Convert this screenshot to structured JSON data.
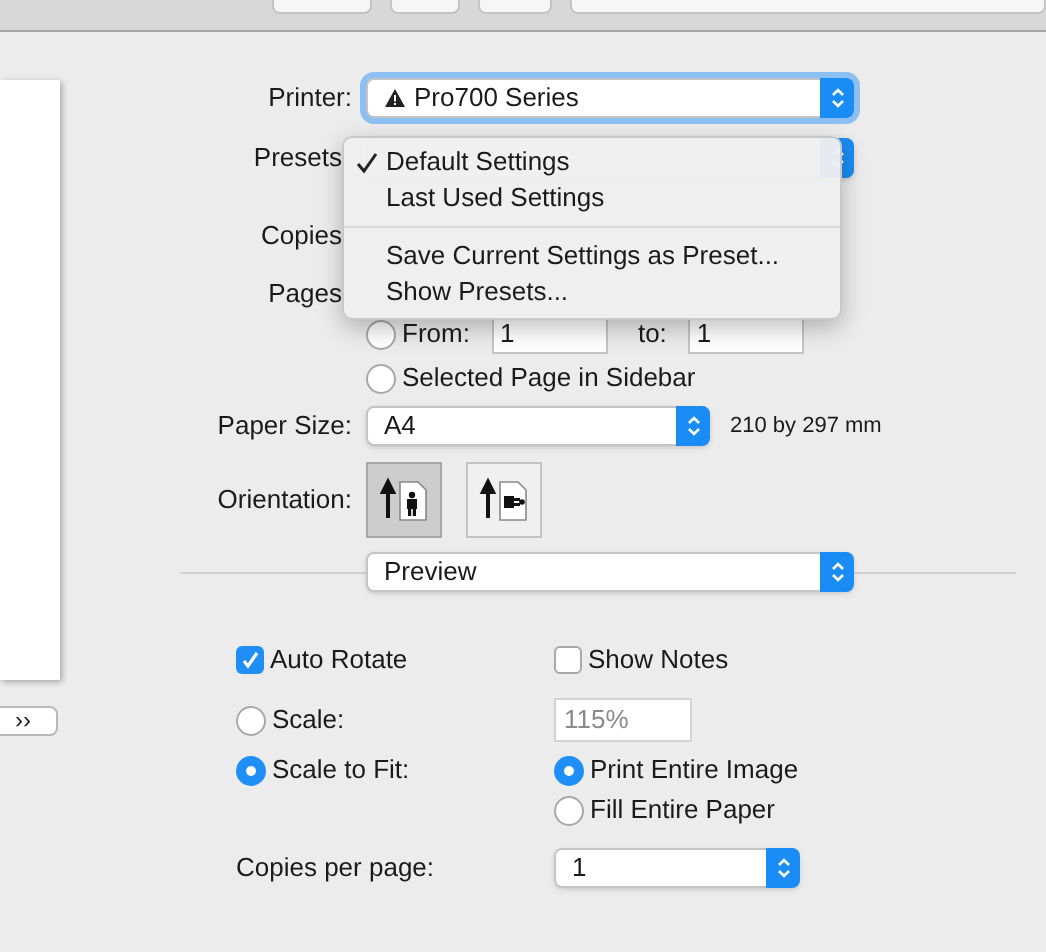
{
  "sidebar_toggle": {
    "label": "››"
  },
  "printer": {
    "label": "Printer:",
    "value": "Pro700 Series",
    "focused": true
  },
  "presets": {
    "label": "Presets",
    "menu": {
      "groups": [
        [
          {
            "label": "Default Settings",
            "selected": true
          },
          {
            "label": "Last Used Settings",
            "selected": false
          }
        ],
        [
          {
            "label": "Save Current Settings as Preset...",
            "selected": false
          },
          {
            "label": "Show Presets...",
            "selected": false
          }
        ]
      ]
    }
  },
  "copies": {
    "label": "Copies"
  },
  "pages": {
    "label": "Pages",
    "from": {
      "label": "From:",
      "value": "1",
      "selected": false
    },
    "to": {
      "label": "to:",
      "value": "1"
    },
    "sidebar_option": {
      "label": "Selected Page in Sidebar",
      "selected": false
    }
  },
  "paper_size": {
    "label": "Paper Size:",
    "value": "A4",
    "dimensions": "210 by 297 mm"
  },
  "orientation": {
    "label": "Orientation:",
    "options": [
      {
        "kind": "portrait",
        "selected": true
      },
      {
        "kind": "landscape",
        "selected": false
      }
    ]
  },
  "app_section": {
    "value": "Preview"
  },
  "auto_rotate": {
    "label": "Auto Rotate",
    "checked": true
  },
  "show_notes": {
    "label": "Show Notes",
    "checked": false
  },
  "scale": {
    "label": "Scale:",
    "selected": false,
    "field": {
      "value": "115%",
      "disabled": true
    }
  },
  "scale_to_fit": {
    "label": "Scale to Fit:",
    "selected": true,
    "options": [
      {
        "label": "Print Entire Image",
        "selected": true
      },
      {
        "label": "Fill Entire Paper",
        "selected": false
      }
    ]
  },
  "copies_per_page": {
    "label": "Copies per page:",
    "value": "1"
  }
}
